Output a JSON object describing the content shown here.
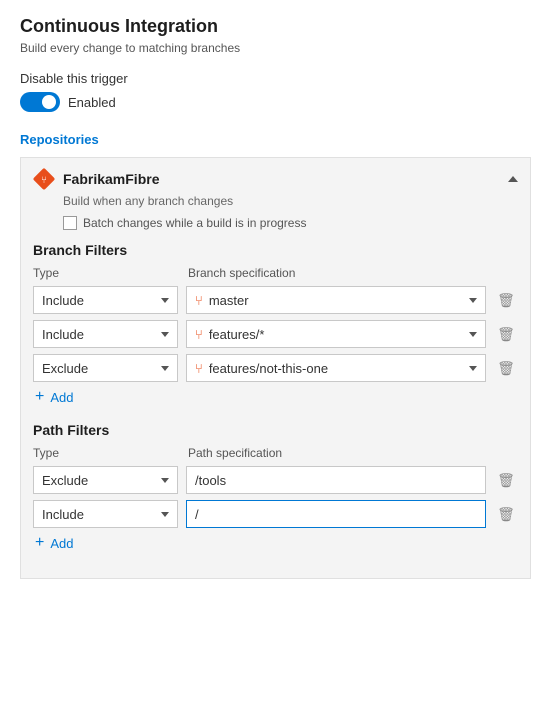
{
  "header": {
    "title": "Continuous Integration",
    "subtitle": "Build every change to matching branches"
  },
  "trigger": {
    "disable_label": "Disable this trigger",
    "toggle_state": "Enabled",
    "enabled": true
  },
  "repositories": {
    "section_label": "Repositories",
    "items": [
      {
        "name": "FabrikamFibre",
        "subtitle": "Build when any branch changes",
        "batch_label": "Batch changes while a build is in progress"
      }
    ]
  },
  "branch_filters": {
    "section_label": "Branch Filters",
    "type_col_label": "Type",
    "spec_col_label": "Branch specification",
    "rows": [
      {
        "type": "Include",
        "spec": "master"
      },
      {
        "type": "Include",
        "spec": "features/*"
      },
      {
        "type": "Exclude",
        "spec": "features/not-this-one"
      }
    ],
    "add_label": "Add"
  },
  "path_filters": {
    "section_label": "Path Filters",
    "type_col_label": "Type",
    "spec_col_label": "Path specification",
    "rows": [
      {
        "type": "Exclude",
        "spec": "/tools"
      },
      {
        "type": "Include",
        "spec": "/"
      }
    ],
    "add_label": "Add"
  },
  "icons": {
    "branch": "⑂",
    "delete": "🗑",
    "plus": "+"
  }
}
